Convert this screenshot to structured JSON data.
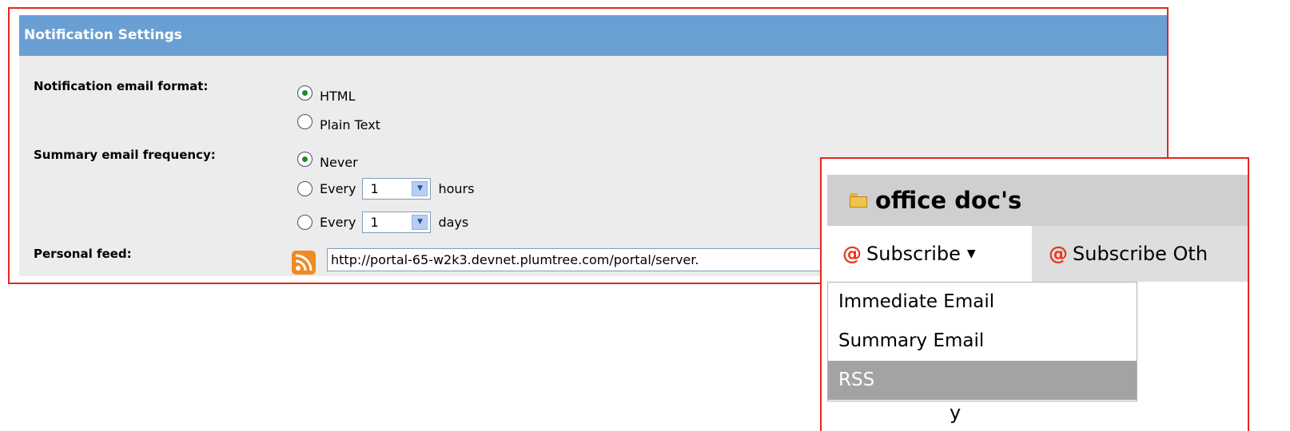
{
  "settings": {
    "title": "Notification Settings",
    "format_label": "Notification email format:",
    "format_options": [
      "HTML",
      "Plain Text"
    ],
    "format_selected": "HTML",
    "frequency_label": "Summary email frequency:",
    "freq_never": "Never",
    "freq_every": "Every",
    "freq_hours_value": "1",
    "freq_hours_unit": "hours",
    "freq_days_value": "1",
    "freq_days_unit": "days",
    "frequency_selected": "Never",
    "feed_label": "Personal feed:",
    "feed_url": "http://portal-65-w2k3.devnet.plumtree.com/portal/server."
  },
  "overlay": {
    "title": "office doc's",
    "subscribe": "Subscribe",
    "subscribe_other": "Subscribe Oth",
    "at_symbol": "@",
    "menu_items": [
      "Immediate Email",
      "Summary Email",
      "RSS"
    ],
    "menu_selected": "RSS",
    "below_fragment": "y"
  },
  "colors": {
    "header_bg": "#6a9fd3",
    "callout_border": "#e3281c",
    "panel_bg": "#ececec"
  }
}
